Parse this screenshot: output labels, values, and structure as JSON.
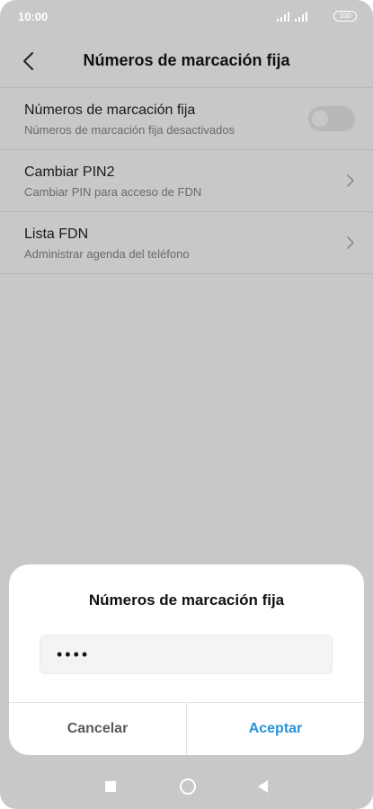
{
  "status_bar": {
    "time": "10:00",
    "battery": "100"
  },
  "app_bar": {
    "title": "Números de marcación fija",
    "back_icon": "chevron-left-icon"
  },
  "settings": [
    {
      "title": "Números de marcación fija",
      "subtitle": "Números de marcación fija desactivados",
      "control": "toggle",
      "toggle_on": false
    },
    {
      "title": "Cambiar PIN2",
      "subtitle": "Cambiar PIN para acceso de FDN",
      "control": "chevron-right-icon"
    },
    {
      "title": "Lista FDN",
      "subtitle": "Administrar agenda del teléfono",
      "control": "chevron-right-icon"
    }
  ],
  "dialog": {
    "title": "Números de marcación fija",
    "pin_value": "••••",
    "cancel_label": "Cancelar",
    "accept_label": "Aceptar"
  },
  "nav_bar": {
    "icons": [
      "recents-square-icon",
      "home-circle-icon",
      "back-triangle-icon"
    ]
  },
  "colors": {
    "accent": "#2a93d8",
    "scrim_background": "#c8c8c8"
  }
}
